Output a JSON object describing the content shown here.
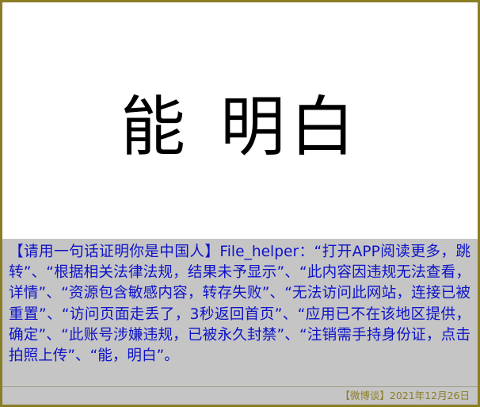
{
  "hero": {
    "part1": "能",
    "part2": "明白"
  },
  "caption": {
    "text": "【请用一句话证明你是中国人】File_helper：“打开APP阅读更多，跳转”、“根据相关法律法规，结果未予显示”、“此内容因违规无法查看，详情”、“资源包含敏感内容，转存失败”、“无法访问此网站，连接已被重置”、“访问页面走丢了，3秒返回首页”、“应用已不在该地区提供，确定”、“此账号涉嫌违规，已被永久封禁”、“注销需手持身份证，点击拍照上传”、“能，明白”。"
  },
  "footer": {
    "source_date": "【微博谈】2021年12月26日"
  },
  "colors": {
    "border": "#8b7d25",
    "caption_background": "#c5c5c5",
    "caption_text": "#0d12c8",
    "footer_text": "#8b7d25"
  }
}
